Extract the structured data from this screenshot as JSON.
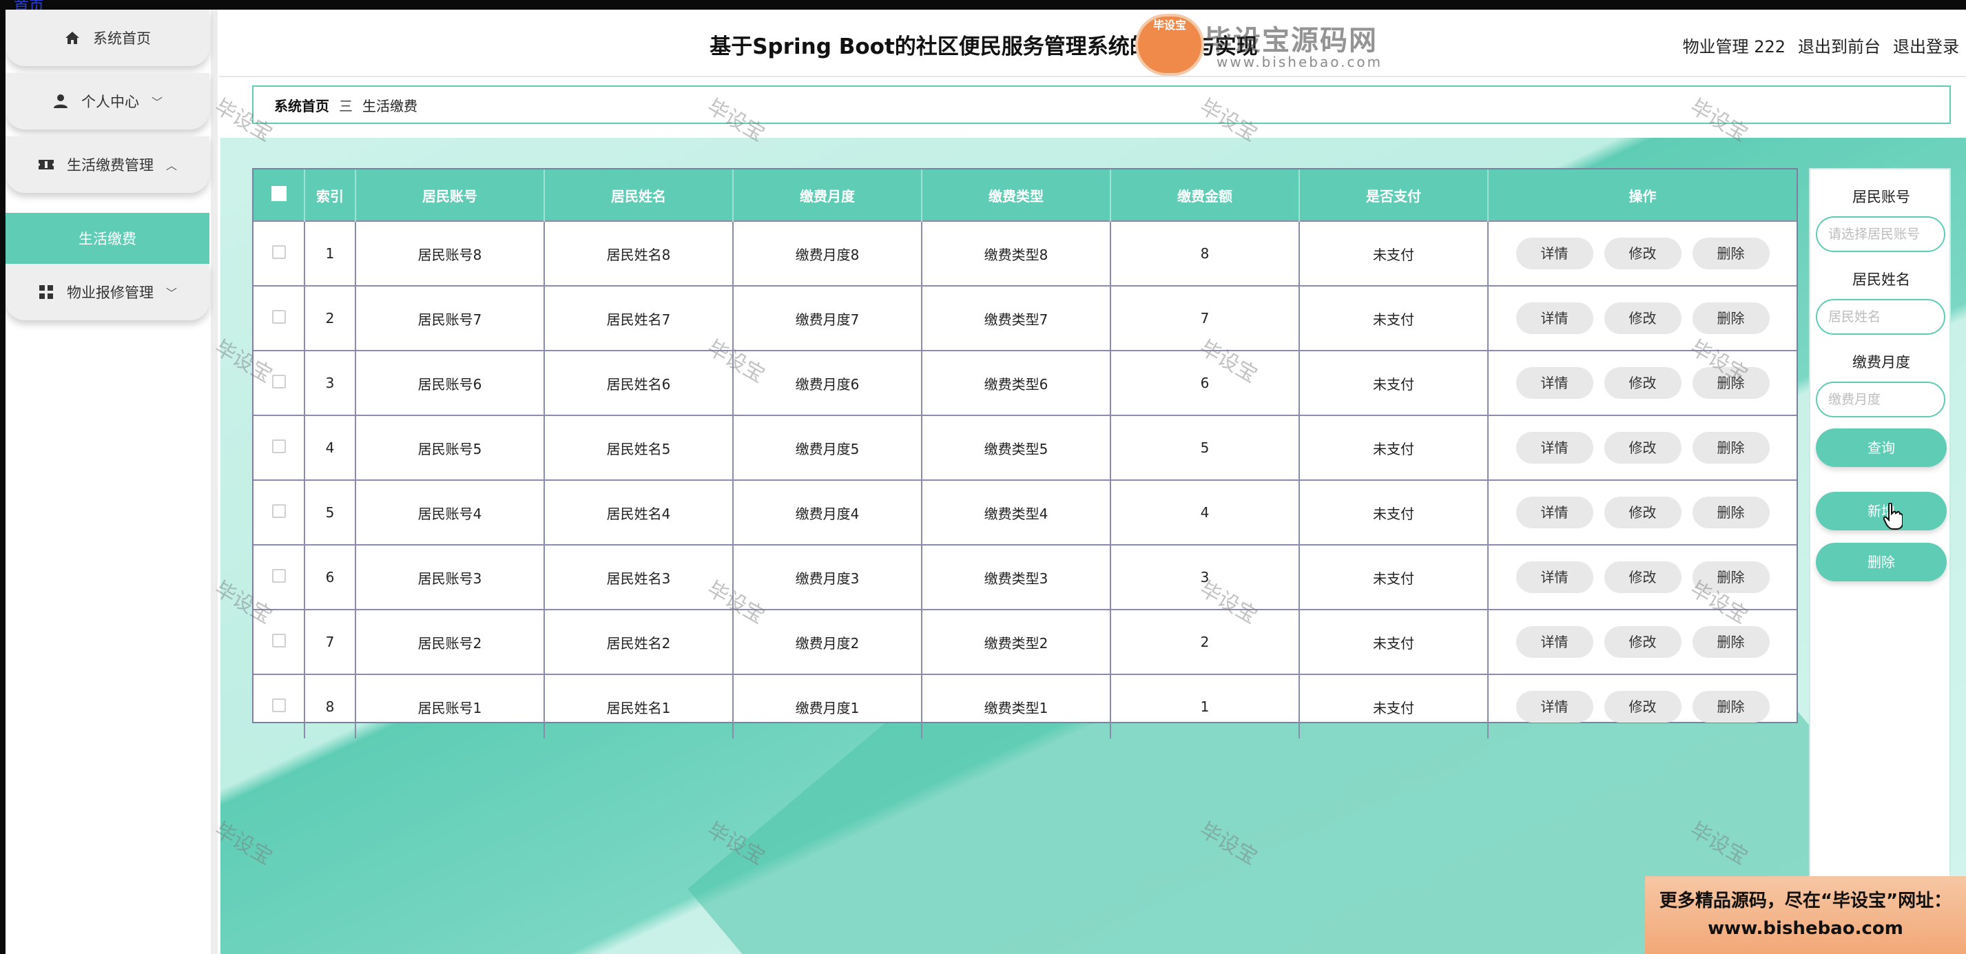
{
  "topbar": {
    "link_text": "首页"
  },
  "sidebar": {
    "items": [
      {
        "label": "系统首页",
        "icon": "home-icon"
      },
      {
        "label": "个人中心",
        "icon": "user-icon",
        "chevron": "﹀"
      },
      {
        "label": "生活缴费管理",
        "icon": "ticket-icon",
        "chevron": "︿"
      },
      {
        "label": "生活缴费"
      },
      {
        "label": "物业报修管理",
        "icon": "grid-icon",
        "chevron": "﹀"
      }
    ]
  },
  "header": {
    "title": "基于Spring Boot的社区便民服务管理系统的设计与实现",
    "user": "物业管理 222",
    "to_front": "退出到前台",
    "logout": "退出登录"
  },
  "logo": {
    "badge": "毕设宝",
    "text": "毕设宝源码网",
    "url": "www.bishebao.com"
  },
  "breadcrumb": {
    "home": "系统首页",
    "sep": "三",
    "current": "生活缴费"
  },
  "table": {
    "headers": [
      "索引",
      "居民账号",
      "居民姓名",
      "缴费月度",
      "缴费类型",
      "缴费金额",
      "是否支付",
      "操作"
    ],
    "rows": [
      {
        "index": "1",
        "account": "居民账号8",
        "name": "居民姓名8",
        "month": "缴费月度8",
        "type": "缴费类型8",
        "amount": "8",
        "paid": "未支付"
      },
      {
        "index": "2",
        "account": "居民账号7",
        "name": "居民姓名7",
        "month": "缴费月度7",
        "type": "缴费类型7",
        "amount": "7",
        "paid": "未支付"
      },
      {
        "index": "3",
        "account": "居民账号6",
        "name": "居民姓名6",
        "month": "缴费月度6",
        "type": "缴费类型6",
        "amount": "6",
        "paid": "未支付"
      },
      {
        "index": "4",
        "account": "居民账号5",
        "name": "居民姓名5",
        "month": "缴费月度5",
        "type": "缴费类型5",
        "amount": "5",
        "paid": "未支付"
      },
      {
        "index": "5",
        "account": "居民账号4",
        "name": "居民姓名4",
        "month": "缴费月度4",
        "type": "缴费类型4",
        "amount": "4",
        "paid": "未支付"
      },
      {
        "index": "6",
        "account": "居民账号3",
        "name": "居民姓名3",
        "month": "缴费月度3",
        "type": "缴费类型3",
        "amount": "3",
        "paid": "未支付"
      },
      {
        "index": "7",
        "account": "居民账号2",
        "name": "居民姓名2",
        "month": "缴费月度2",
        "type": "缴费类型2",
        "amount": "2",
        "paid": "未支付"
      },
      {
        "index": "8",
        "account": "居民账号1",
        "name": "居民姓名1",
        "month": "缴费月度1",
        "type": "缴费类型1",
        "amount": "1",
        "paid": "未支付"
      }
    ],
    "actions": {
      "detail": "详情",
      "edit": "修改",
      "delete": "删除"
    }
  },
  "search_panel": {
    "account_label": "居民账号",
    "account_placeholder": "请选择居民账号",
    "name_label": "居民姓名",
    "name_placeholder": "居民姓名",
    "month_label": "缴费月度",
    "month_placeholder": "缴费月度",
    "query": "查询",
    "add": "新增",
    "delete": "删除"
  },
  "watermark": "毕设宝",
  "promo": {
    "line1": "更多精品源码，尽在“毕设宝”网址：",
    "line2": "www.bishebao.com"
  },
  "colors": {
    "accent": "#5fcdb5",
    "menu_bg": "#eeeeee",
    "button_bg": "#e8e8e8"
  }
}
